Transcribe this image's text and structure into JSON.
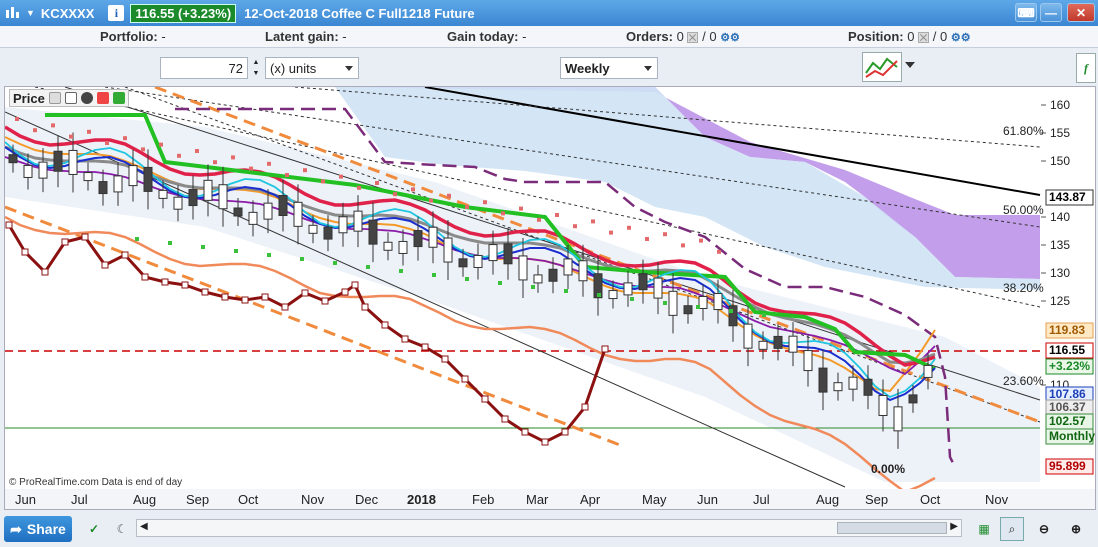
{
  "titlebar": {
    "symbol": "KCXXXX",
    "info": "i",
    "price": "116.55 (+3.23%)",
    "description": "12-Oct-2018 Coffee C Full1218 Future"
  },
  "infobar": {
    "portfolio_label": "Portfolio:",
    "portfolio_value": "-",
    "latent_label": "Latent gain:",
    "latent_value": "-",
    "gain_today_label": "Gain today:",
    "gain_today_value": "-",
    "orders_label": "Orders:",
    "orders_count": "0",
    "orders_sep": "/",
    "orders_count2": "0",
    "position_label": "Position:",
    "position_count": "0",
    "position_sep": "/",
    "position_count2": "0"
  },
  "toolbar": {
    "units_value": "72",
    "units_label": "(x) units",
    "period_value": "Weekly"
  },
  "chart_panel": {
    "label": "Price",
    "copyright": "© ProRealTime.com  Data is end of day"
  },
  "price_axis": {
    "ticks": [
      "160",
      "155",
      "150",
      "140",
      "135",
      "130",
      "125",
      "110"
    ],
    "tags": [
      {
        "text": "143.87",
        "bg": "#ffffff",
        "fg": "#000000",
        "border": "#333333"
      },
      {
        "text": "119.83",
        "bg": "#ffe9c4",
        "fg": "#a05a00",
        "border": "#e0a050"
      },
      {
        "text": "116.55",
        "bg": "#ffffff",
        "fg": "#000000",
        "border": "#cc0000"
      },
      {
        "text": "+3.23%",
        "bg": "#eaf7e6",
        "fg": "#1a8a2a",
        "border": "#1a8a2a"
      },
      {
        "text": "107.86",
        "bg": "#e6efff",
        "fg": "#1a3fb8",
        "border": "#1a3fb8"
      },
      {
        "text": "106.37",
        "bg": "#eeeeee",
        "fg": "#555555",
        "border": "#999999"
      },
      {
        "text": "102.57",
        "bg": "#e8f6e8",
        "fg": "#116611",
        "border": "#3a8a3a"
      },
      {
        "text": "Monthly",
        "bg": "#e8f6e8",
        "fg": "#116611",
        "border": "#3a8a3a"
      },
      {
        "text": "95.899",
        "bg": "#ffeaea",
        "fg": "#b00000",
        "border": "#cc0000"
      }
    ]
  },
  "fib_labels": [
    "61.80%",
    "50.00%",
    "38.20%",
    "23.60%",
    "0.00%"
  ],
  "time_axis": [
    "Jun",
    "Jul",
    "Aug",
    "Sep",
    "Oct",
    "Nov",
    "Dec",
    "2018",
    "Feb",
    "Mar",
    "Apr",
    "May",
    "Jun",
    "Jul",
    "Aug",
    "Sep",
    "Oct",
    "Nov"
  ],
  "bottombar": {
    "share_label": "Share"
  },
  "colors": {
    "title_bg": "#3a86d2",
    "positive": "#1a8a2a",
    "ichimoku_cloud": "#b98ee8",
    "last_price_line": "#cc0000"
  }
}
